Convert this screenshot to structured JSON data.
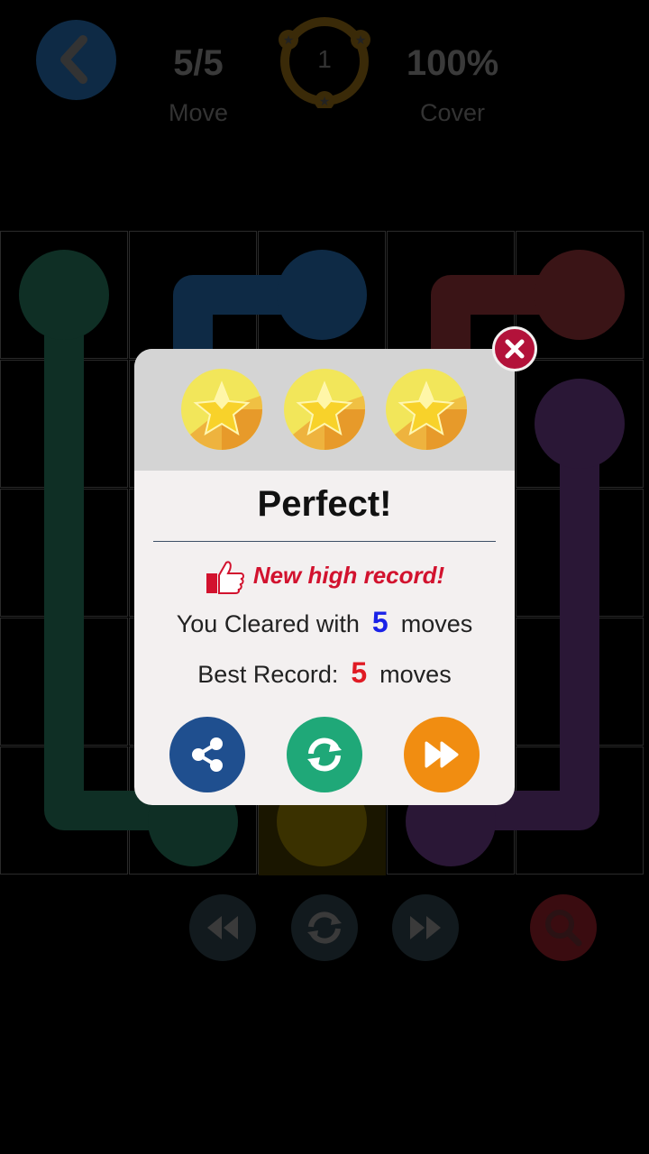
{
  "header": {
    "moves_value": "5/5",
    "moves_label": "Move",
    "level_number": "1",
    "cover_value": "100%",
    "cover_label": "Cover"
  },
  "dialog": {
    "title": "Perfect!",
    "record_text": "New high record!",
    "cleared_prefix": "You Cleared with",
    "cleared_moves": "5",
    "cleared_suffix": "moves",
    "best_prefix": "Best Record:",
    "best_moves": "5",
    "best_suffix": "moves",
    "stars_earned": 3
  },
  "colors": {
    "green": "#0f2f25",
    "blue": "#0e2a45",
    "red": "#3a1416",
    "purple": "#2a1736",
    "yellow": "#3a3100",
    "share": "#1f4f8f",
    "retry": "#1fa878",
    "next": "#f18d11",
    "close": "#b3123a"
  }
}
